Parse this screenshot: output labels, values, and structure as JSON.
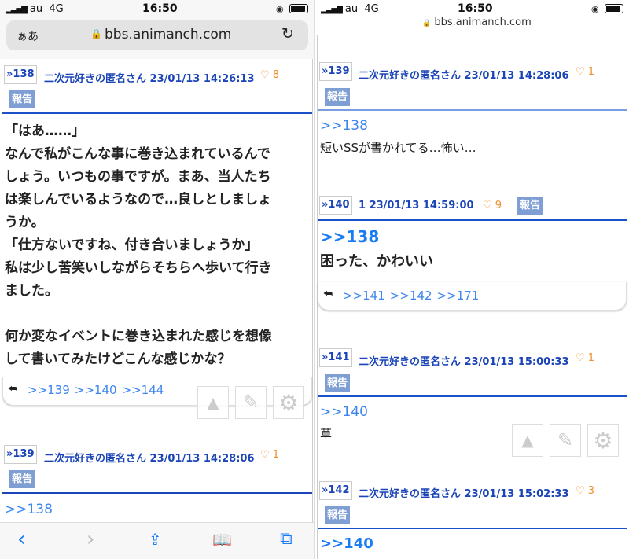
{
  "status": {
    "carrier": "au",
    "network": "4G",
    "time": "16:50"
  },
  "browser": {
    "text_size": "ぁあ",
    "url": "bbs.animanch.com"
  },
  "left": {
    "post138": {
      "num": "138",
      "author": "二次元好きの匿名さん",
      "date": "23/01/13 14:26:13",
      "likes": "8",
      "report": "報告",
      "body": [
        "「はあ……」",
        "なんで私がこんな事に巻き込まれているんで",
        "しょう。いつもの事ですが。まあ、当人たち",
        "は楽しんでいるようなので…良しとしましょ",
        "うか。",
        "「仕方ないですね、付き合いましょうか」",
        "私は少し苦笑いしながらそちらへ歩いて行き",
        "ました。",
        "",
        "何か変なイベントに巻き込まれた感じを想像",
        "して書いてみたけどこんな感じかな？"
      ],
      "replies": [
        ">>139",
        ">>140",
        ">>144"
      ]
    },
    "post139": {
      "num": "139",
      "author": "二次元好きの匿名さん",
      "date": "23/01/13 14:28:06",
      "likes": "1",
      "report": "報告",
      "anchor": ">>138"
    }
  },
  "right": {
    "post139": {
      "num": "139",
      "author": "二次元好きの匿名さん",
      "date": "23/01/13 14:28:06",
      "likes": "1",
      "report": "報告",
      "anchor": ">>138",
      "body": "短いSSが書かれてる…怖い…"
    },
    "post140": {
      "num": "140",
      "author": "1",
      "date": "23/01/13 14:59:00",
      "likes": "9",
      "report": "報告",
      "anchor": ">>138",
      "body": "困った、かわいい",
      "replies": [
        ">>141",
        ">>142",
        ">>171"
      ]
    },
    "post141": {
      "num": "141",
      "author": "二次元好きの匿名さん",
      "date": "23/01/13 15:00:33",
      "likes": "1",
      "report": "報告",
      "anchor": ">>140",
      "body": "草"
    },
    "post142": {
      "num": "142",
      "author": "二次元好きの匿名さん",
      "date": "23/01/13 15:02:33",
      "likes": "3",
      "report": "報告",
      "anchor": ">>140"
    }
  },
  "colors": {
    "link": "#1a44b8",
    "like": "#f0902a",
    "report": "#7f9fd4",
    "ios_blue": "#1a7cf5"
  }
}
